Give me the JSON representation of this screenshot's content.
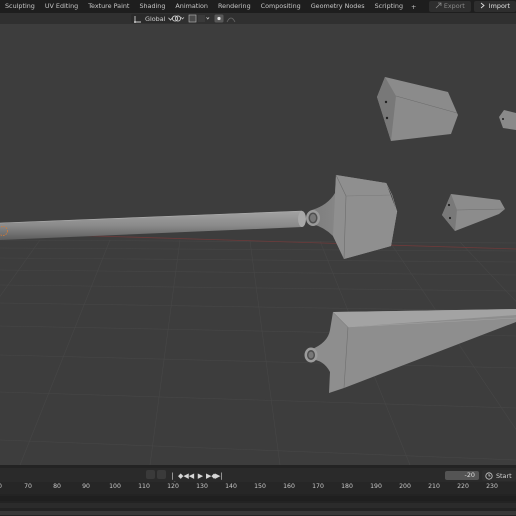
{
  "workspace_tabs": [
    "Sculpting",
    "UV Editing",
    "Texture Paint",
    "Shading",
    "Animation",
    "Rendering",
    "Compositing",
    "Geometry Nodes",
    "Scripting"
  ],
  "add_tab": "+",
  "top_right": {
    "export_label": "Export",
    "import_label": "Import"
  },
  "viewport_header": {
    "transform_orientation": "Global"
  },
  "timeline": {
    "ruler_ticks": [
      "0",
      "70",
      "80",
      "90",
      "100",
      "110",
      "120",
      "130",
      "140",
      "150",
      "160",
      "170",
      "180",
      "190",
      "200",
      "210",
      "220",
      "230"
    ],
    "current_frame": "-20",
    "start_label": "Start"
  },
  "colors": {
    "viewport_bg": "#3d3d3d",
    "grid_line": "#474747",
    "x_axis": "#6f3a3a",
    "mesh": "#8a8a8a",
    "header": "#1e1e1e"
  },
  "icons": [
    "object-origin-icon",
    "orientation-icon",
    "pivot-icon",
    "snap-icon",
    "proportional-icon",
    "visibility-icon",
    "gizmo-icon",
    "overlay-icon",
    "jump-start-icon",
    "prev-keyframe-icon",
    "play-reverse-icon",
    "play-icon",
    "next-keyframe-icon",
    "jump-end-icon",
    "clock-icon"
  ]
}
